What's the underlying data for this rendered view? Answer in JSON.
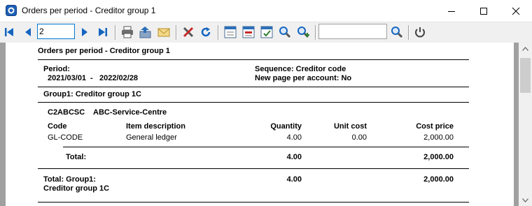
{
  "window": {
    "title": "Orders per period - Creditor group 1",
    "controls": [
      "minimize-icon",
      "maximize-icon",
      "close-icon"
    ]
  },
  "toolbar": {
    "page_value": "2",
    "search_value": "",
    "icons": [
      "first-page-icon",
      "previous-page-icon",
      "next-page-icon",
      "last-page-icon",
      "print-icon",
      "export-icon",
      "email-icon",
      "tools-icon",
      "refresh-icon",
      "layout-1-icon",
      "layout-2-icon",
      "layout-3-icon",
      "zoom-icon",
      "zoom-in-icon",
      "search-icon",
      "stop-icon"
    ]
  },
  "report": {
    "title": "Orders per period - Creditor group 1",
    "period_label": "Period:",
    "period_from": "2021/03/01",
    "period_dash": "-",
    "period_to": "2022/02/28",
    "sequence": "Sequence:  Creditor code",
    "new_page": "New page per account: No",
    "group_header": "Group1: Creditor group 1C",
    "creditor_code": "C2ABCSC",
    "creditor_name": "ABC-Service-Centre",
    "columns": {
      "code": "Code",
      "description": "Item description",
      "quantity": "Quantity",
      "unit_cost": "Unit cost",
      "cost_price": "Cost price"
    },
    "rows": [
      {
        "code": "GL-CODE",
        "description": "General ledger",
        "quantity": "4.00",
        "unit_cost": "0.00",
        "cost_price": "2,000.00"
      }
    ],
    "total_label": "Total:",
    "total_quantity": "4.00",
    "total_cost_price": "2,000.00",
    "group_total_label_1": "Total: Group1:",
    "group_total_label_2": "Creditor group 1C",
    "group_total_quantity": "4.00",
    "group_total_cost_price": "2,000.00"
  }
}
